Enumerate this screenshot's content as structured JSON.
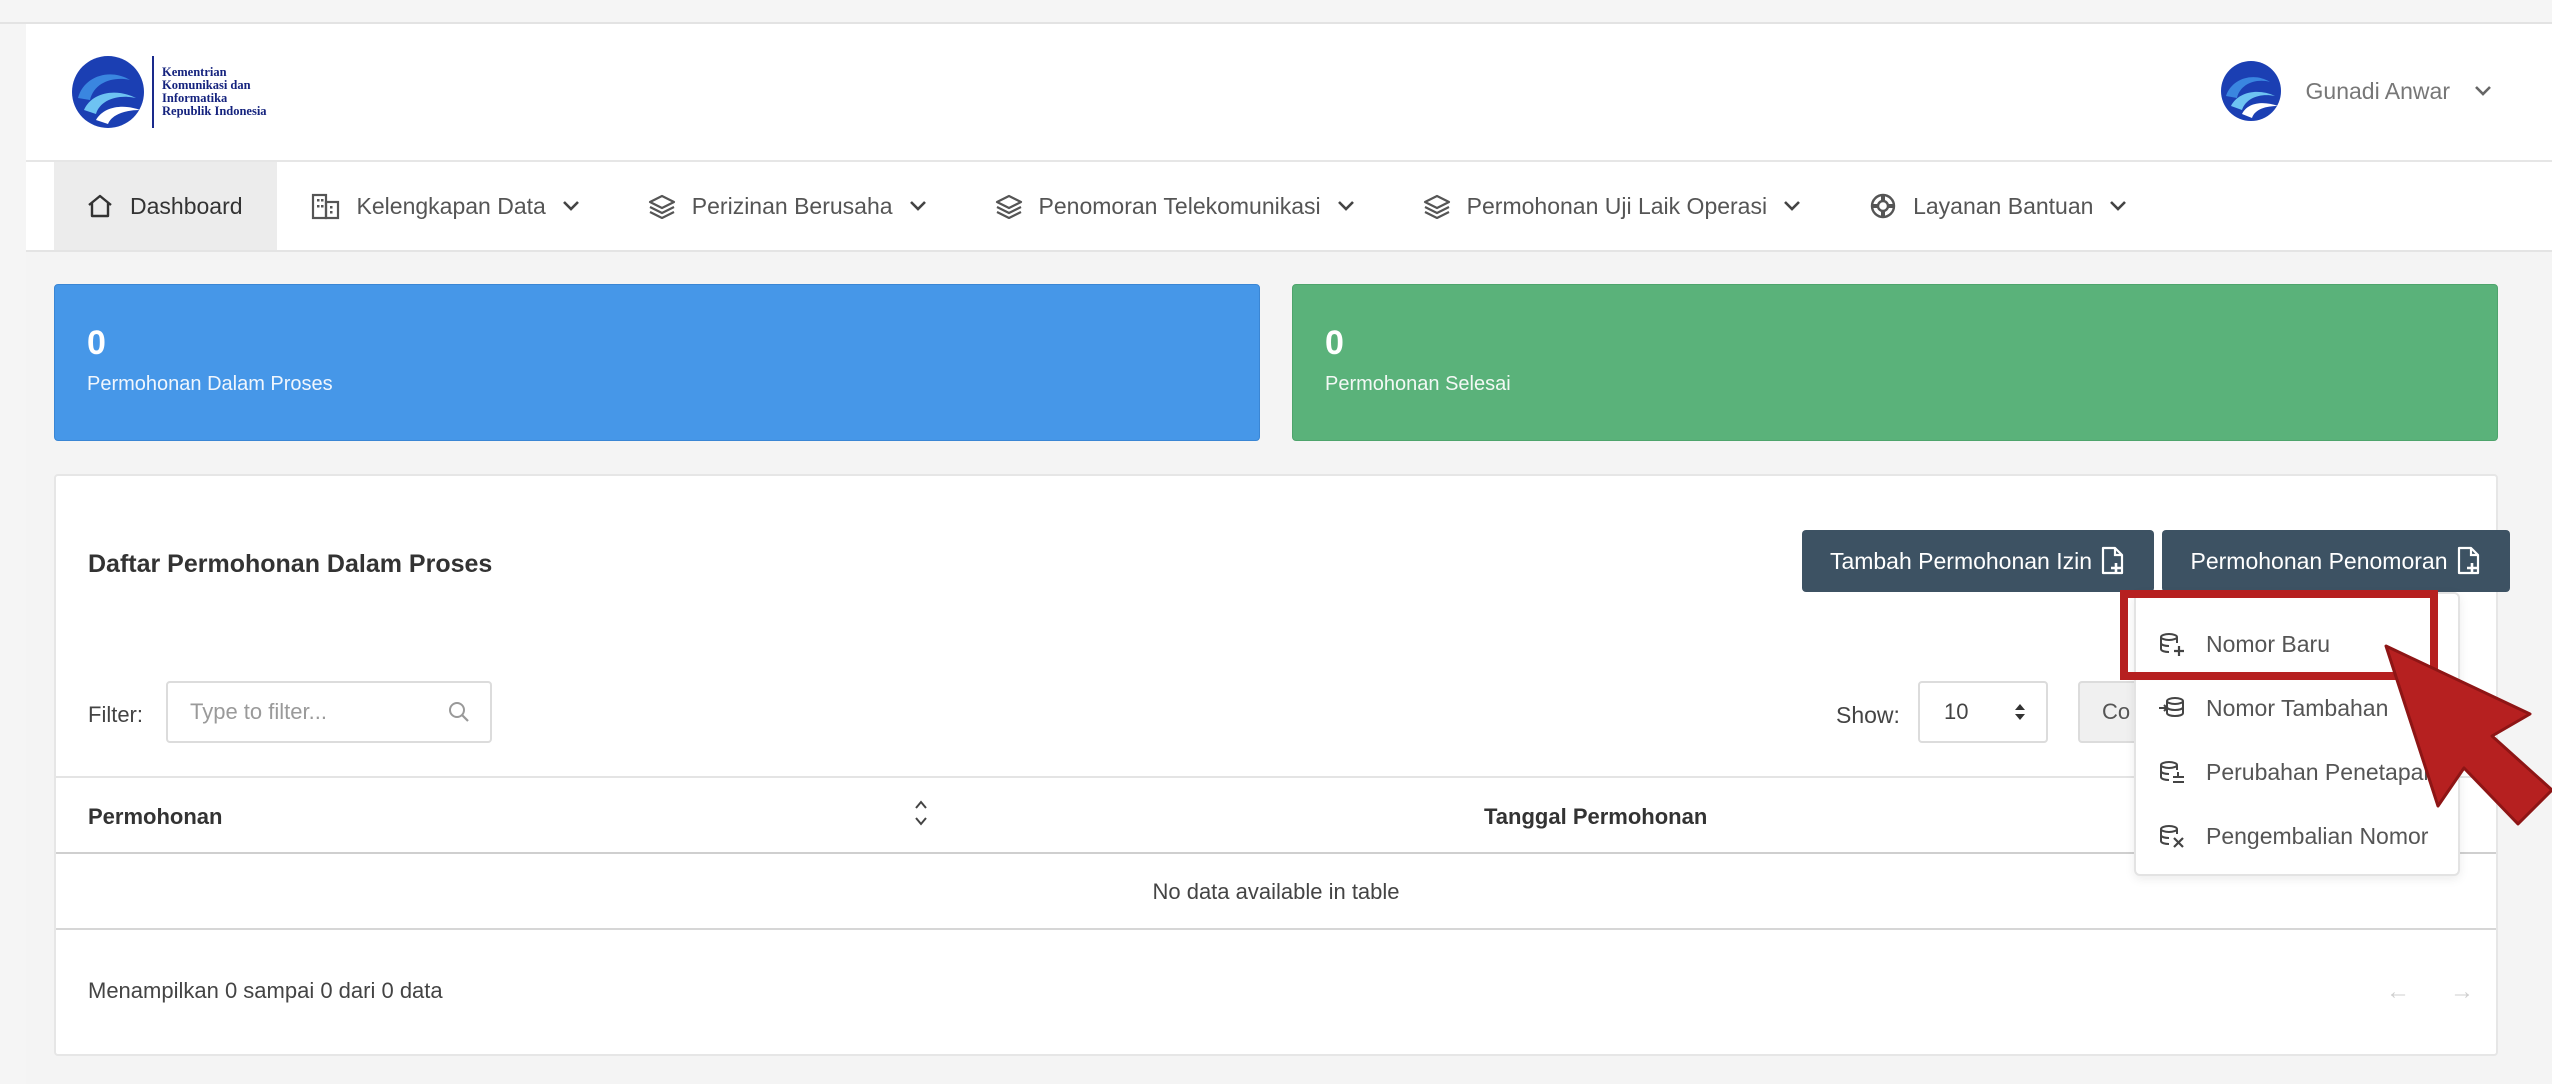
{
  "header": {
    "logo_lines": [
      "Kementrian",
      "Komunikasi dan",
      "Informatika",
      "Republik Indonesia"
    ],
    "user_name": "Gunadi Anwar"
  },
  "nav": {
    "items": [
      {
        "label": "Dashboard",
        "icon": "home-icon"
      },
      {
        "label": "Kelengkapan Data",
        "icon": "building-icon"
      },
      {
        "label": "Perizinan Berusaha",
        "icon": "layers-icon"
      },
      {
        "label": "Penomoran Telekomunikasi",
        "icon": "layers-icon"
      },
      {
        "label": "Permohonan Uji Laik Operasi",
        "icon": "layers-icon"
      },
      {
        "label": "Layanan Bantuan",
        "icon": "lifebuoy-icon"
      }
    ]
  },
  "stats": {
    "in_process": {
      "value": "0",
      "label": "Permohonan Dalam Proses",
      "color": "#4697e8"
    },
    "done": {
      "value": "0",
      "label": "Permohonan Selesai",
      "color": "#5ab27a"
    }
  },
  "card": {
    "title": "Daftar Permohonan Dalam Proses",
    "btn_izin": "Tambah Permohonan Izin",
    "btn_penomoran": "Permohonan Penomoran",
    "filter_label": "Filter:",
    "filter_placeholder": "Type to filter...",
    "show_label": "Show:",
    "show_value": "10",
    "columns_btn": "Co",
    "col_permohonan": "Permohonan",
    "col_tanggal": "Tanggal Permohonan",
    "empty_text": "No data available in table",
    "footer_info": "Menampilkan 0 sampai 0 dari 0 data",
    "pager_prev": "←",
    "pager_next": "→"
  },
  "dropdown": {
    "items": [
      {
        "label": "Nomor Baru",
        "icon": "database-plus-icon"
      },
      {
        "label": "Nomor Tambahan",
        "icon": "database-import-icon"
      },
      {
        "label": "Perubahan Penetapan",
        "icon": "database-edit-icon"
      },
      {
        "label": "Pengembalian Nomor",
        "icon": "database-remove-icon"
      }
    ]
  },
  "colors": {
    "button": "#3d5263",
    "highlight": "#b62020"
  }
}
